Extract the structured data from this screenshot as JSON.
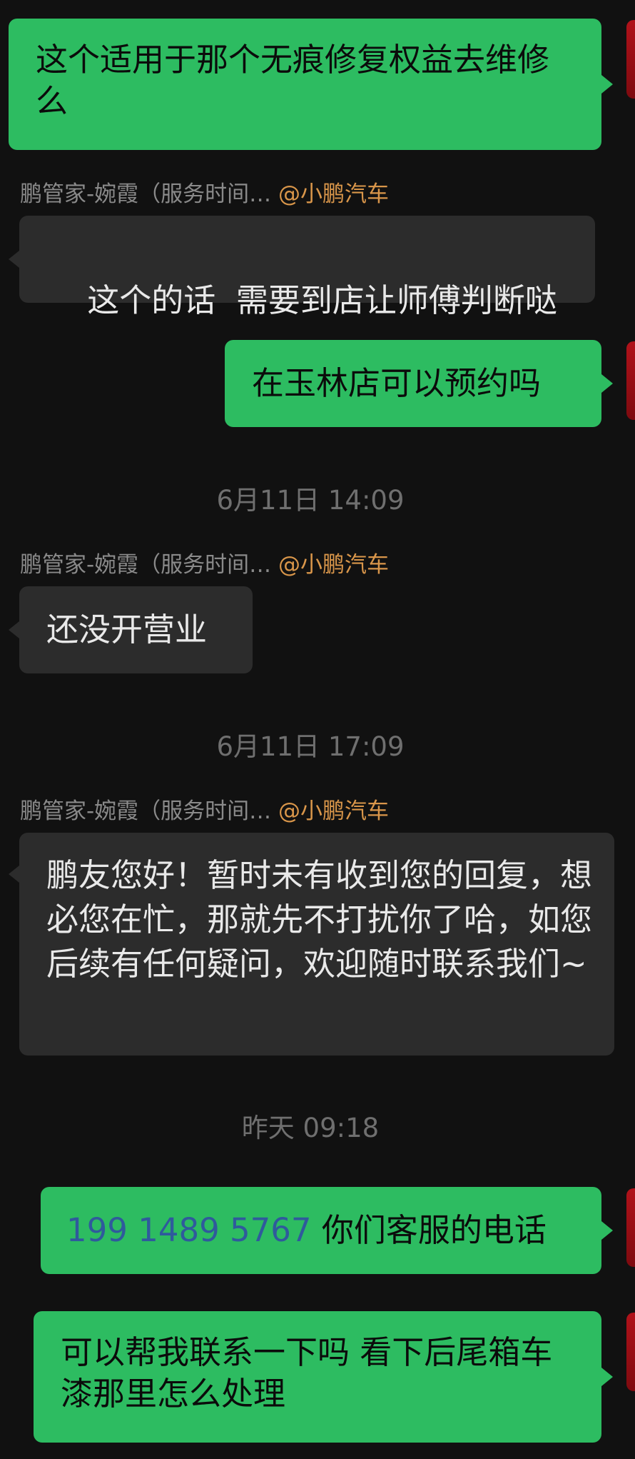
{
  "messages": [
    {
      "id": "m1",
      "direction": "out",
      "text": "这个适用于那个无痕修复权益去维修么"
    },
    {
      "id": "m2",
      "direction": "in",
      "sender_name": "鹏管家-婉霞（服务时间…",
      "sender_org": "@小鹏汽车",
      "text": "这个的话  需要到店让师傅判断哒"
    },
    {
      "id": "m3",
      "direction": "out",
      "text": "在玉林店可以预约吗"
    },
    {
      "id": "t1",
      "type": "timestamp",
      "text": "6月11日 14:09"
    },
    {
      "id": "m4",
      "direction": "in",
      "sender_name": "鹏管家-婉霞（服务时间…",
      "sender_org": "@小鹏汽车",
      "text": "还没开营业"
    },
    {
      "id": "t2",
      "type": "timestamp",
      "text": "6月11日 17:09"
    },
    {
      "id": "m5",
      "direction": "in",
      "sender_name": "鹏管家-婉霞（服务时间…",
      "sender_org": "@小鹏汽车",
      "text": "鹏友您好！暂时未有收到您的回复，想必您在忙，那就先不打扰你了哈，如您后续有任何疑问，欢迎随时联系我们~"
    },
    {
      "id": "t3",
      "type": "timestamp",
      "text": "昨天 09:18"
    },
    {
      "id": "m6",
      "direction": "out",
      "phone": "199 1489 5767",
      "text": "你们客服的电话"
    },
    {
      "id": "m7",
      "direction": "out",
      "text": "可以帮我联系一下吗 看下后尾箱车漆那里怎么处理"
    }
  ],
  "colors": {
    "background": "#111111",
    "outgoing_bubble": "#2dbc61",
    "incoming_bubble": "#2c2c2c",
    "sender_name": "#8a8a8a",
    "sender_org": "#d9964a",
    "timestamp": "#6f6f6f",
    "phone_link": "#2f5a9c",
    "avatar": "#b1121a"
  }
}
